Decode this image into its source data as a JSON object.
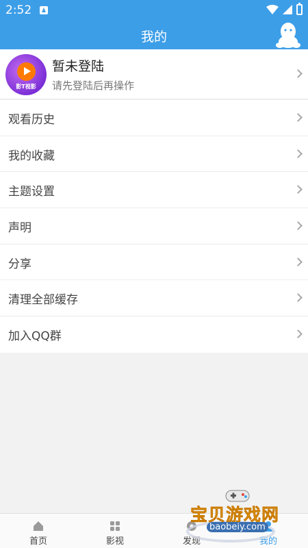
{
  "status_bar": {
    "time": "2:52"
  },
  "header": {
    "title": "我的"
  },
  "profile": {
    "logo_text": "影T视影",
    "title": "暂未登陆",
    "subtitle": "请先登陆后再操作"
  },
  "menu": {
    "items": [
      {
        "label": "观看历史"
      },
      {
        "label": "我的收藏"
      },
      {
        "label": "主题设置"
      },
      {
        "label": "声明"
      },
      {
        "label": "分享"
      },
      {
        "label": "清理全部缓存"
      },
      {
        "label": "加入QQ群"
      }
    ]
  },
  "tabbar": {
    "active_index": 3,
    "tabs": [
      {
        "label": "首页",
        "icon": "home-icon"
      },
      {
        "label": "影视",
        "icon": "grid-icon"
      },
      {
        "label": "发现",
        "icon": "discover-icon"
      },
      {
        "label": "我的",
        "icon": "profile-icon"
      }
    ]
  },
  "watermark": {
    "title": "宝贝游戏网",
    "url": "baobeiy.com"
  },
  "colors": {
    "primary": "#3d9ee8",
    "background": "#f2f2f2"
  }
}
